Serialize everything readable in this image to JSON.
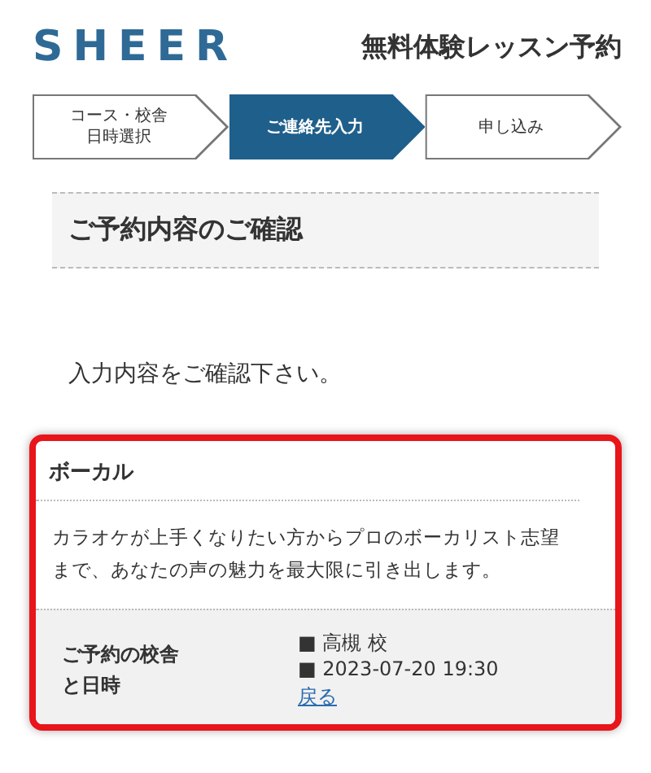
{
  "header": {
    "logo": "SHEER",
    "title": "無料体験レッスン予約"
  },
  "steps": [
    {
      "label": "コース・校舎日時選択",
      "selected": false
    },
    {
      "label": "ご連絡先入力",
      "selected": true
    },
    {
      "label": "申し込み",
      "selected": false
    }
  ],
  "section_heading": "ご予約内容のご確認",
  "instruction": "入力内容をご確認下さい。",
  "course_card": {
    "title": "ボーカル",
    "description": "カラオケが上手くなりたい方からプロのボーカリスト志望まで、あなたの声の魅力を最大限に引き出します。",
    "detail_label": "ご予約の校舎と日時",
    "values": [
      "■ 高槻 校",
      "■ 2023-07-20 19:30"
    ],
    "back_link": "戻る"
  }
}
